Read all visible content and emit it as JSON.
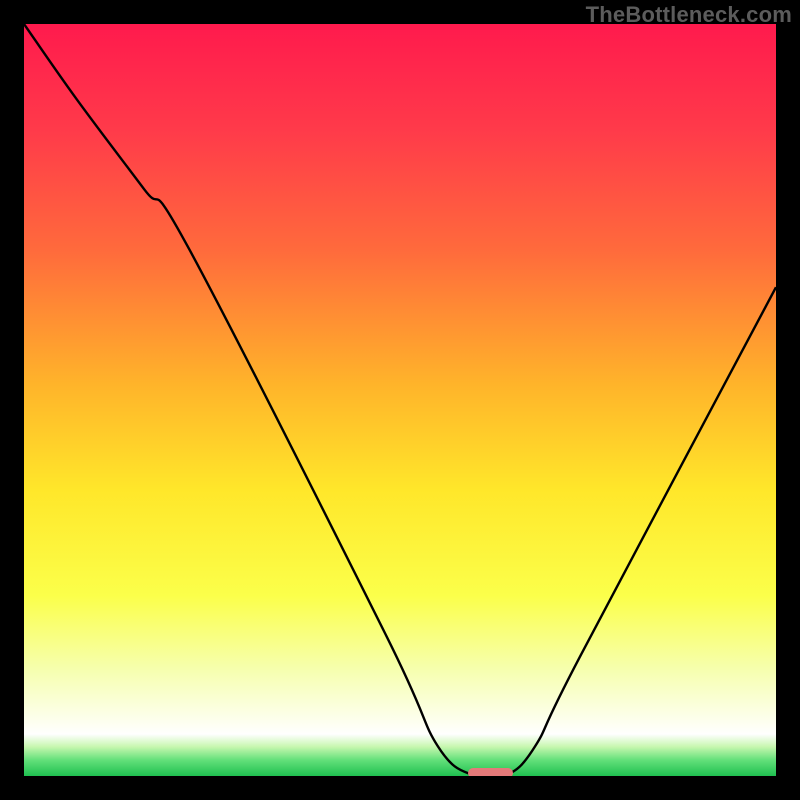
{
  "watermark": "TheBottleneck.com",
  "chart_data": {
    "type": "line",
    "title": "",
    "xlabel": "",
    "ylabel": "",
    "xlim": [
      0,
      100
    ],
    "ylim": [
      0,
      100
    ],
    "grid": false,
    "legend": false,
    "series": [
      {
        "name": "bottleneck-curve",
        "x": [
          0,
          7,
          16,
          22,
          48,
          55,
          60,
          64,
          68,
          74,
          100
        ],
        "y": [
          100,
          90,
          78,
          70,
          19,
          4,
          0,
          0,
          4,
          16,
          65
        ]
      }
    ],
    "annotations": [
      {
        "name": "optimal-marker",
        "x": 62,
        "y": 0.4,
        "width": 6
      }
    ],
    "background_gradient_stops": [
      {
        "pos": 0.0,
        "color": "#ff1a4d"
      },
      {
        "pos": 0.14,
        "color": "#ff3a4a"
      },
      {
        "pos": 0.3,
        "color": "#ff6a3c"
      },
      {
        "pos": 0.48,
        "color": "#ffb42a"
      },
      {
        "pos": 0.62,
        "color": "#ffe72a"
      },
      {
        "pos": 0.76,
        "color": "#fbff4a"
      },
      {
        "pos": 0.86,
        "color": "#f6ffb0"
      },
      {
        "pos": 0.945,
        "color": "#ffffff"
      }
    ],
    "bottom_band_gradient_stops": [
      {
        "pos": 0.0,
        "color": "#ffffff"
      },
      {
        "pos": 0.3,
        "color": "#c8f7b0"
      },
      {
        "pos": 0.62,
        "color": "#63e07a"
      },
      {
        "pos": 1.0,
        "color": "#1fc050"
      }
    ]
  }
}
